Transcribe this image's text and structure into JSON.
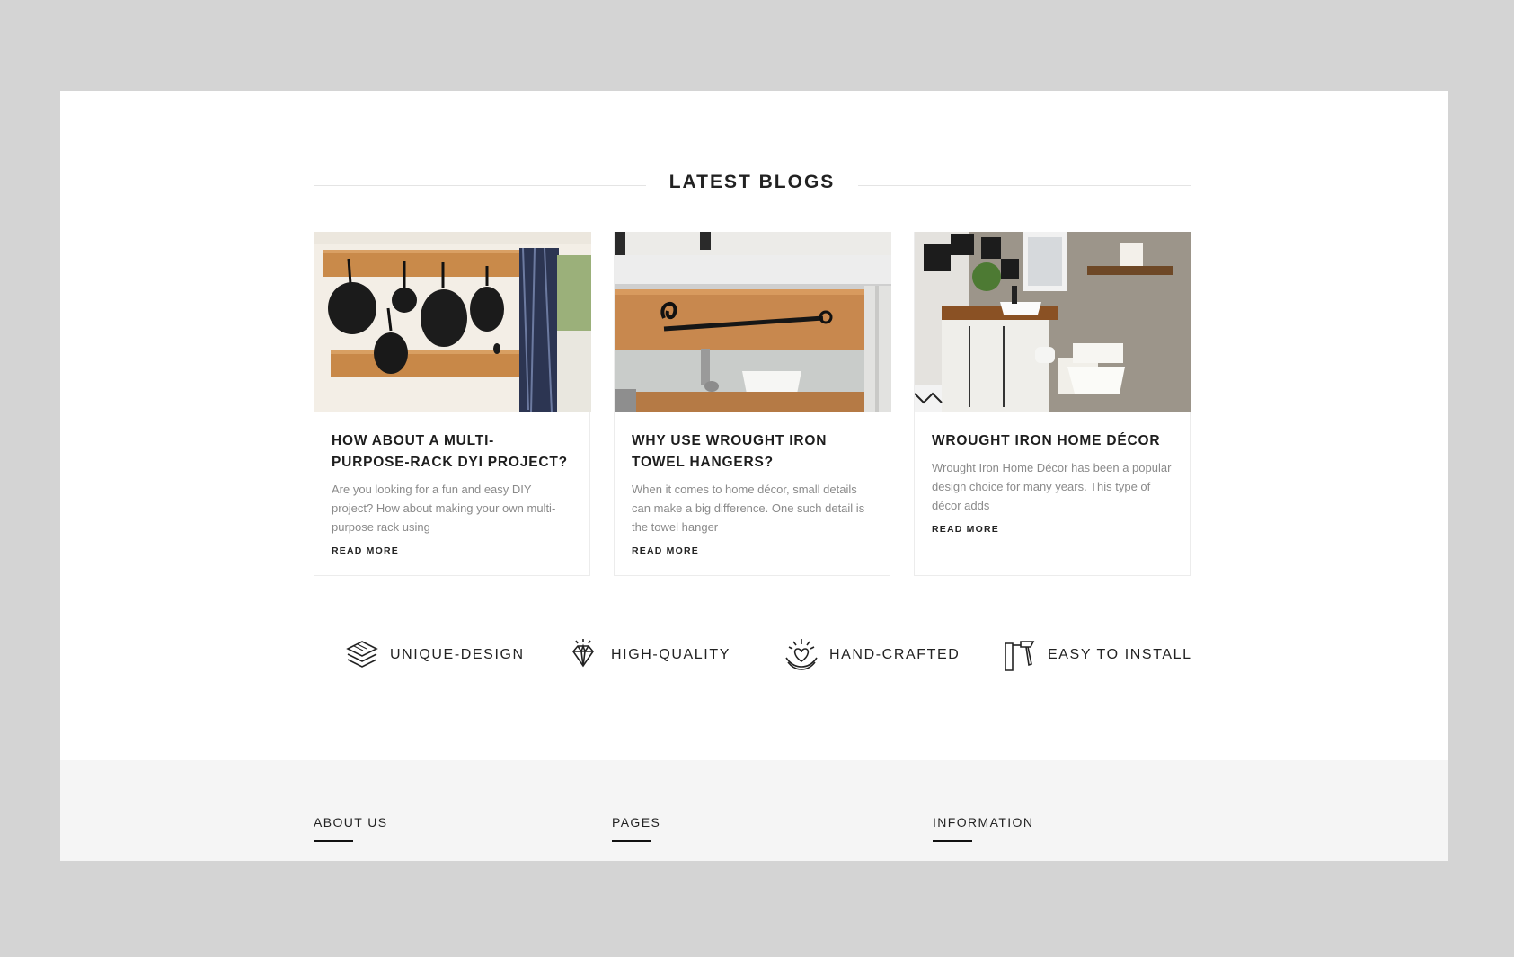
{
  "section": {
    "title": "LATEST BLOGS"
  },
  "blogs": [
    {
      "title": "HOW ABOUT A MULTI-PURPOSE-RACK DYI PROJECT?",
      "excerpt": "Are you looking for a fun and easy DIY project? How about making your own multi-purpose rack using",
      "read_more": "READ MORE",
      "image": "kitchen-pans-rack-photo"
    },
    {
      "title": "WHY USE WROUGHT IRON TOWEL HANGERS?",
      "excerpt": "When it comes to home décor, small details can make a big difference. One such detail is the towel hanger",
      "read_more": "READ MORE",
      "image": "vanity-towel-hanger-photo"
    },
    {
      "title": "WROUGHT IRON HOME DÉCOR",
      "excerpt": "Wrought Iron Home Décor has been a popular design choice for many years. This type of décor adds",
      "read_more": "READ MORE",
      "image": "bathroom-decor-photo"
    }
  ],
  "features": [
    {
      "label": "UNIQUE-DESIGN",
      "icon": "layers-icon"
    },
    {
      "label": "HIGH-QUALITY",
      "icon": "diamond-icon"
    },
    {
      "label": "HAND-CRAFTED",
      "icon": "heart-hands-icon"
    },
    {
      "label": "EASY TO INSTALL",
      "icon": "hammer-icon"
    }
  ],
  "footer": {
    "about": "ABOUT US",
    "pages": "PAGES",
    "information": "INFORMATION"
  },
  "colors": {
    "background": "#d4d4d4",
    "page": "#ffffff",
    "footer": "#f5f5f5",
    "text": "#1c1c1c",
    "muted": "#8a8a8a"
  }
}
